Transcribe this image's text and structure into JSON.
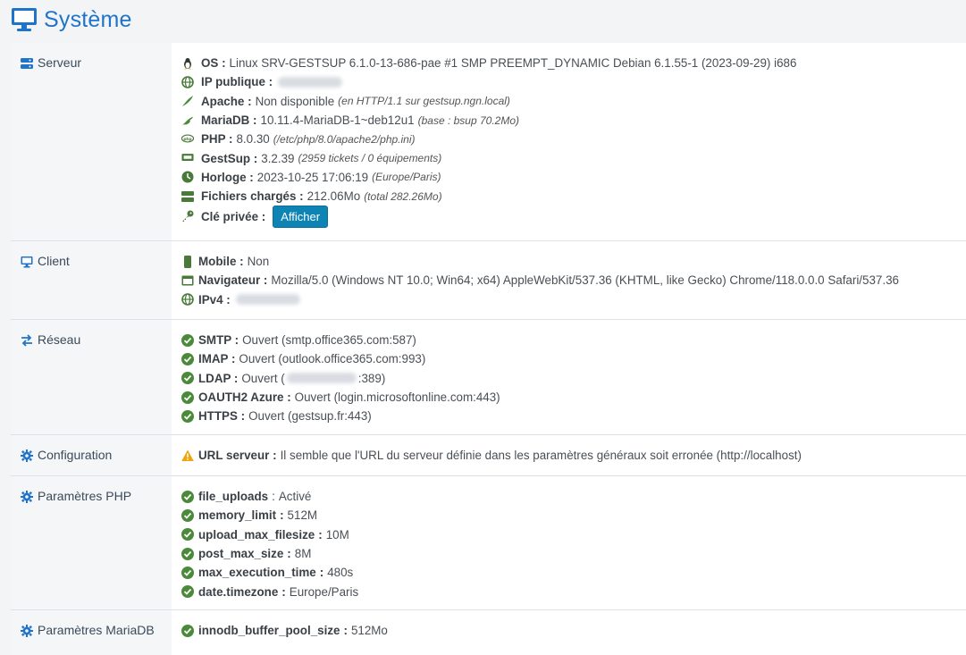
{
  "page": {
    "title": "Système"
  },
  "sections": {
    "server": {
      "label": "Serveur",
      "os": {
        "key": "OS :",
        "value": "Linux SRV-GESTSUP 6.1.0-13-686-pae #1 SMP PREEMPT_DYNAMIC Debian 6.1.55-1 (2023-09-29) i686"
      },
      "ip": {
        "key": "IP publique :"
      },
      "apache": {
        "key": "Apache :",
        "value": "Non disponible",
        "note": "(en HTTP/1.1 sur gestsup.ngn.local)"
      },
      "mariadb": {
        "key": "MariaDB :",
        "value": "10.11.4-MariaDB-1~deb12u1",
        "note": "(base : bsup 70.2Mo)"
      },
      "php": {
        "key": "PHP :",
        "value": "8.0.30",
        "note": "(/etc/php/8.0/apache2/php.ini)"
      },
      "gestsup": {
        "key": "GestSup :",
        "value": "3.2.39",
        "note": "(2959 tickets / 0 équipements)"
      },
      "clock": {
        "key": "Horloge :",
        "value": "2023-10-25 17:06:19",
        "note": "(Europe/Paris)"
      },
      "files": {
        "key": "Fichiers chargés :",
        "value": "212.06Mo",
        "note": "(total 282.26Mo)"
      },
      "key": {
        "key": "Clé privée :",
        "button": "Afficher"
      }
    },
    "client": {
      "label": "Client",
      "mobile": {
        "key": "Mobile :",
        "value": "Non"
      },
      "browser": {
        "key": "Navigateur :",
        "value": "Mozilla/5.0 (Windows NT 10.0; Win64; x64) AppleWebKit/537.36 (KHTML, like Gecko) Chrome/118.0.0.0 Safari/537.36"
      },
      "ipv4": {
        "key": "IPv4 :"
      }
    },
    "network": {
      "label": "Réseau",
      "smtp": {
        "key": "SMTP :",
        "value": "Ouvert (smtp.office365.com:587)"
      },
      "imap": {
        "key": "IMAP :",
        "value": "Ouvert (outlook.office365.com:993)"
      },
      "ldap": {
        "key": "LDAP :",
        "value_prefix": "Ouvert (",
        "value_suffix": ":389)"
      },
      "oauth": {
        "key": "OAUTH2 Azure :",
        "value": "Ouvert (login.microsoftonline.com:443)"
      },
      "https": {
        "key": "HTTPS :",
        "value": "Ouvert (gestsup.fr:443)"
      }
    },
    "config": {
      "label": "Configuration",
      "url": {
        "key": "URL serveur :",
        "value": "Il semble que l'URL du serveur définie dans les paramètres généraux soit erronée (http://localhost)"
      }
    },
    "php_params": {
      "label": "Paramètres PHP",
      "items": [
        {
          "key": "file_uploads",
          "value": "Activé"
        },
        {
          "key": "memory_limit",
          "value": "512M"
        },
        {
          "key": "upload_max_filesize",
          "value": "10M"
        },
        {
          "key": "post_max_size",
          "value": "8M"
        },
        {
          "key": "max_execution_time",
          "value": "480s"
        },
        {
          "key": "date.timezone",
          "value": "Europe/Paris"
        }
      ],
      "separator": ":"
    },
    "mariadb_params": {
      "label": "Paramètres MariaDB",
      "items": [
        {
          "key": "innodb_buffer_pool_size",
          "value": "512Mo"
        }
      ],
      "separator": ":"
    }
  },
  "colors": {
    "accent": "#1f74c9",
    "ok_green": "#4a8a3a",
    "warning": "#f0a30a",
    "button": "#0e84b4",
    "label_bg": "#f4f6f8"
  }
}
